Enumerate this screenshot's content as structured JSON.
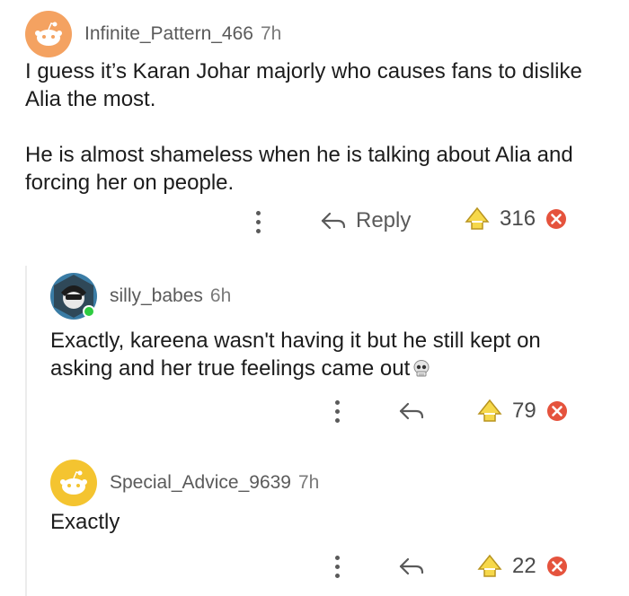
{
  "comments": [
    {
      "username": "Infinite_Pattern_466",
      "time": "7h",
      "paragraphs": [
        "I guess it’s Karan Johar majorly who causes fans to dislike Alia the most.",
        "He is almost shameless when he is talking about Alia and forcing her on people."
      ],
      "reply_label": "Reply",
      "score": "316",
      "avatar_color": "#f4a261"
    },
    {
      "username": "silly_babes",
      "time": "6h",
      "text": "Exactly, kareena wasn't having it but he still kept on asking and her true feelings came out",
      "emoji": "skull-emoji",
      "score": "79",
      "avatar_color": "#3a7ca5"
    },
    {
      "username": "Special_Advice_9639",
      "time": "7h",
      "text": "Exactly",
      "score": "22",
      "avatar_color": "#f4c430"
    }
  ],
  "colors": {
    "upvote_yellow": "#f6d84a",
    "downvote_red": "#e5533d",
    "online_green": "#2ecc40"
  }
}
